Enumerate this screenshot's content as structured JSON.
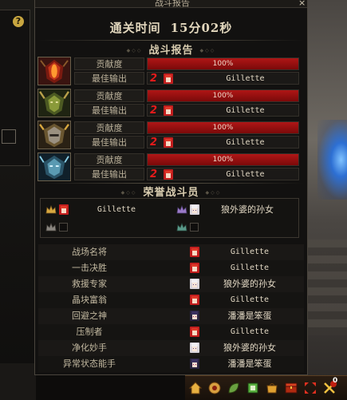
{
  "window": {
    "title": "战斗报告",
    "close_glyph": "×"
  },
  "clear_time": {
    "label": "通关时间",
    "value": "15分02秒"
  },
  "battle_report": {
    "section_title": "战斗报告",
    "contribution_label": "贡献度",
    "best_output_label": "最佳输出",
    "players": [
      {
        "avatar_icon": "red-demon-mask-icon",
        "contribution": "100%",
        "contribution_fraction": 1.0,
        "best_rank": "2",
        "best_name": "Gillette"
      },
      {
        "avatar_icon": "green-horned-mask-icon",
        "contribution": "100%",
        "contribution_fraction": 1.0,
        "best_rank": "2",
        "best_name": "Gillette"
      },
      {
        "avatar_icon": "gold-helm-mask-icon",
        "contribution": "100%",
        "contribution_fraction": 1.0,
        "best_rank": "2",
        "best_name": "Gillette"
      },
      {
        "avatar_icon": "blue-dragon-mask-icon",
        "contribution": "100%",
        "contribution_fraction": 1.0,
        "best_rank": "2",
        "best_name": "Gillette"
      }
    ]
  },
  "honor": {
    "section_title": "荣誉战斗员",
    "members": [
      {
        "name": "Gillette",
        "avatar_icon": "red-haired-character-icon",
        "badge": "gold-crown-icon"
      },
      {
        "name": "狼外婆的孙女",
        "avatar_icon": "white-haired-character-icon",
        "badge": "purple-crown-icon"
      },
      {
        "name": "",
        "avatar_icon": "empty-slot",
        "badge": "silver-crown-icon"
      },
      {
        "name": "",
        "avatar_icon": "empty-slot",
        "badge": "teal-crown-icon"
      }
    ]
  },
  "titles": [
    {
      "label": "战场名将",
      "winner": "Gillette",
      "avatar_icon": "red-haired-character-icon"
    },
    {
      "label": "一击决胜",
      "winner": "Gillette",
      "avatar_icon": "red-haired-character-icon"
    },
    {
      "label": "救援专家",
      "winner": "狼外婆的孙女",
      "avatar_icon": "white-haired-character-icon"
    },
    {
      "label": "晶块富翁",
      "winner": "Gillette",
      "avatar_icon": "red-haired-character-icon"
    },
    {
      "label": "回避之神",
      "winner": "潘潘是笨蛋",
      "avatar_icon": "dark-haired-character-icon"
    },
    {
      "label": "压制者",
      "winner": "Gillette",
      "avatar_icon": "red-haired-character-icon"
    },
    {
      "label": "净化妙手",
      "winner": "狼外婆的孙女",
      "avatar_icon": "white-haired-character-icon"
    },
    {
      "label": "异常状态能手",
      "winner": "潘潘是笨蛋",
      "avatar_icon": "dark-haired-character-icon"
    }
  ],
  "left_panel": {
    "help_glyph": "?"
  },
  "toolbar": {
    "items": [
      "home-icon",
      "mail-icon",
      "leaf-icon",
      "guild-icon",
      "shop-icon",
      "chest-icon",
      "fullscreen-icon",
      "battle-icon"
    ],
    "notification_count": "0"
  },
  "colors": {
    "bar_fill": "#b01616",
    "rank_red": "#e51b1b",
    "accent_gold": "#c8a640"
  }
}
